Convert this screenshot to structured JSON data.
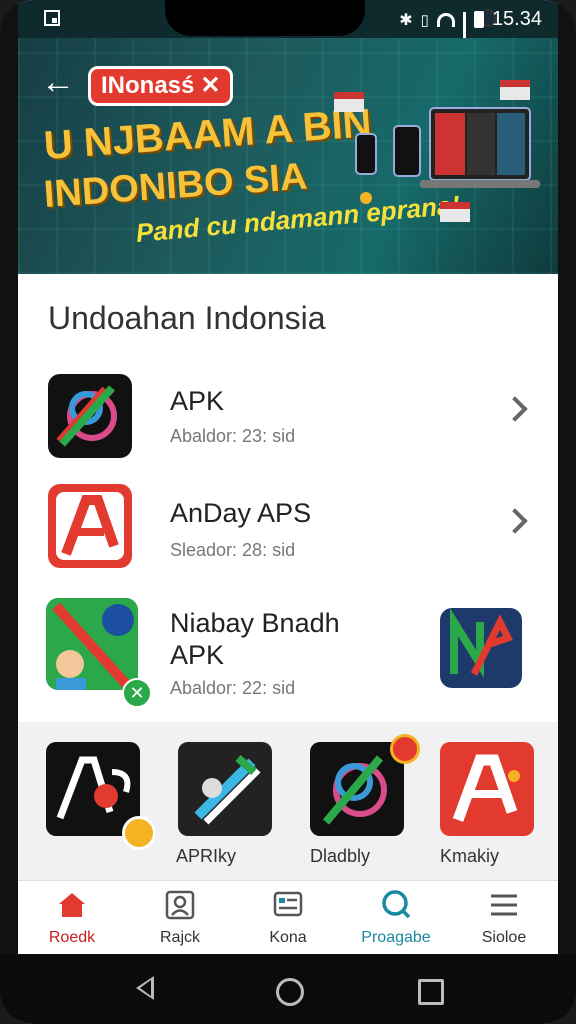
{
  "status_bar": {
    "time": "15.34"
  },
  "banner": {
    "brand": "INonasś",
    "headline_line1": "U NJBAAM A BIN",
    "headline_line2": "INDONIBO SIA",
    "tagline": "Pand cu ndamann eprana!"
  },
  "section": {
    "title": "Undoahan Indonsia"
  },
  "list": [
    {
      "title": "APK",
      "subtitle": "Abaldor: 23: sid"
    },
    {
      "title": "AnDay APS",
      "subtitle": "Sleador: 28: sid"
    },
    {
      "title_line1": "Niabay Bnadh",
      "title_line2": "APK",
      "subtitle": "Abaldor: 22: sid"
    }
  ],
  "shelf": [
    {
      "label": ""
    },
    {
      "label": "APRIky"
    },
    {
      "label": "Dladbly"
    },
    {
      "label": "Kmakiy"
    }
  ],
  "bottom_nav": [
    {
      "label": "Roedk"
    },
    {
      "label": "Rajck"
    },
    {
      "label": "Kona"
    },
    {
      "label": "Proagabe"
    },
    {
      "label": "Sioloe"
    }
  ],
  "colors": {
    "accent_red": "#e23a2e",
    "accent_teal": "#1a8aa0",
    "banner_yellow": "#f6c23a"
  }
}
